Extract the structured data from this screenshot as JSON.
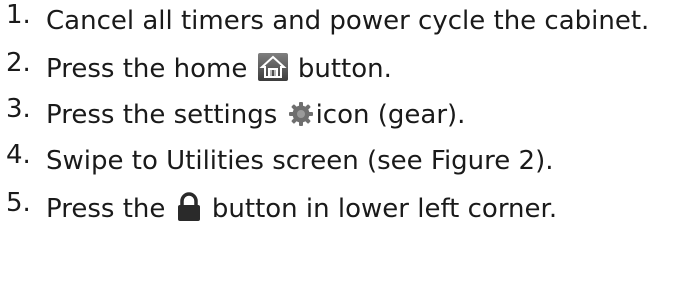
{
  "steps": [
    {
      "number": "1.",
      "text": "Cancel all timers and power cycle the cabinet."
    },
    {
      "number": "2.",
      "before": "Press the home",
      "icon": "home-icon",
      "after": "button."
    },
    {
      "number": "3.",
      "before": "Press the settings",
      "icon": "gear-icon",
      "after": "icon (gear)."
    },
    {
      "number": "4.",
      "text": "Swipe to Utilities screen (see Figure 2)."
    },
    {
      "number": "5.",
      "before": "Press the",
      "icon": "lock-icon",
      "after": "button in lower left corner."
    }
  ],
  "colors": {
    "text": "#1a1a1a",
    "home_icon_bg": "#5a5a5a",
    "icon_dark": "#2a2a2a"
  }
}
